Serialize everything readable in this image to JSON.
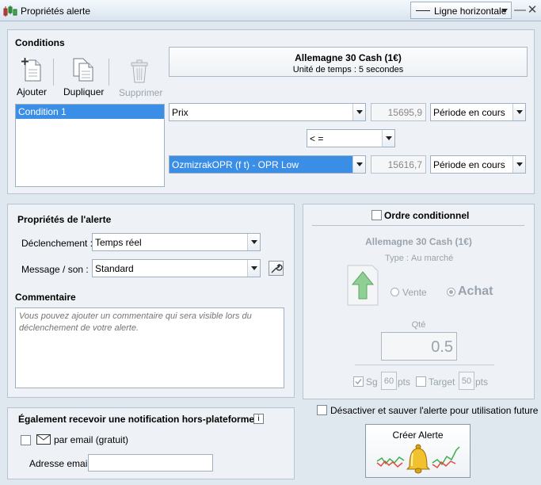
{
  "window": {
    "title": "Propriétés alerte",
    "line_type": "Ligne horizontale",
    "minimize": "—",
    "close": "✕"
  },
  "conditions": {
    "title": "Conditions",
    "toolbar": {
      "add": "Ajouter",
      "duplicate": "Dupliquer",
      "delete": "Supprimer"
    },
    "instrument": {
      "name": "Allemagne 30 Cash (1€)",
      "timeframe": "Unité de temps : 5 secondes"
    },
    "list": [
      "Condition 1"
    ],
    "left_operand": {
      "field": "Prix",
      "value": "15695,9",
      "period": "Période en cours"
    },
    "operator": "< =",
    "right_operand": {
      "field": "OzmizrakOPR (f t) - OPR Low",
      "value": "15616,7",
      "period": "Période en cours"
    }
  },
  "alert_props": {
    "title": "Propriétés de l'alerte",
    "trigger_label": "Déclenchement :",
    "trigger_value": "Temps réel",
    "message_label": "Message / son :",
    "message_value": "Standard",
    "comment_title": "Commentaire",
    "comment_placeholder": "Vous pouvez ajouter un commentaire qui sera visible lors du déclenchement de votre alerte."
  },
  "conditional_order": {
    "checkbox_label": "Ordre conditionnel",
    "instrument": "Allemagne 30 Cash (1€)",
    "type_label": "Type :",
    "type_value": "Au marché",
    "sell": "Vente",
    "buy": "Achat",
    "qty_label": "Qté",
    "qty_value": "0.5",
    "sl_label": "Sg",
    "sl_value": "60",
    "sl_unit": "pts",
    "target_label": "Target",
    "target_value": "50",
    "target_unit": "pts"
  },
  "notification": {
    "title": "Également recevoir une notification hors-plateforme",
    "info": "i",
    "email_label": "par email (gratuit)",
    "address_label": "Adresse email",
    "address_value": ""
  },
  "disable_save_label": "Désactiver et sauver l'alerte pour utilisation future",
  "create_button": "Créer Alerte",
  "colors": {
    "selection": "#3a8ee6",
    "panel": "#eef2f6",
    "window": "#dfe7ef"
  }
}
